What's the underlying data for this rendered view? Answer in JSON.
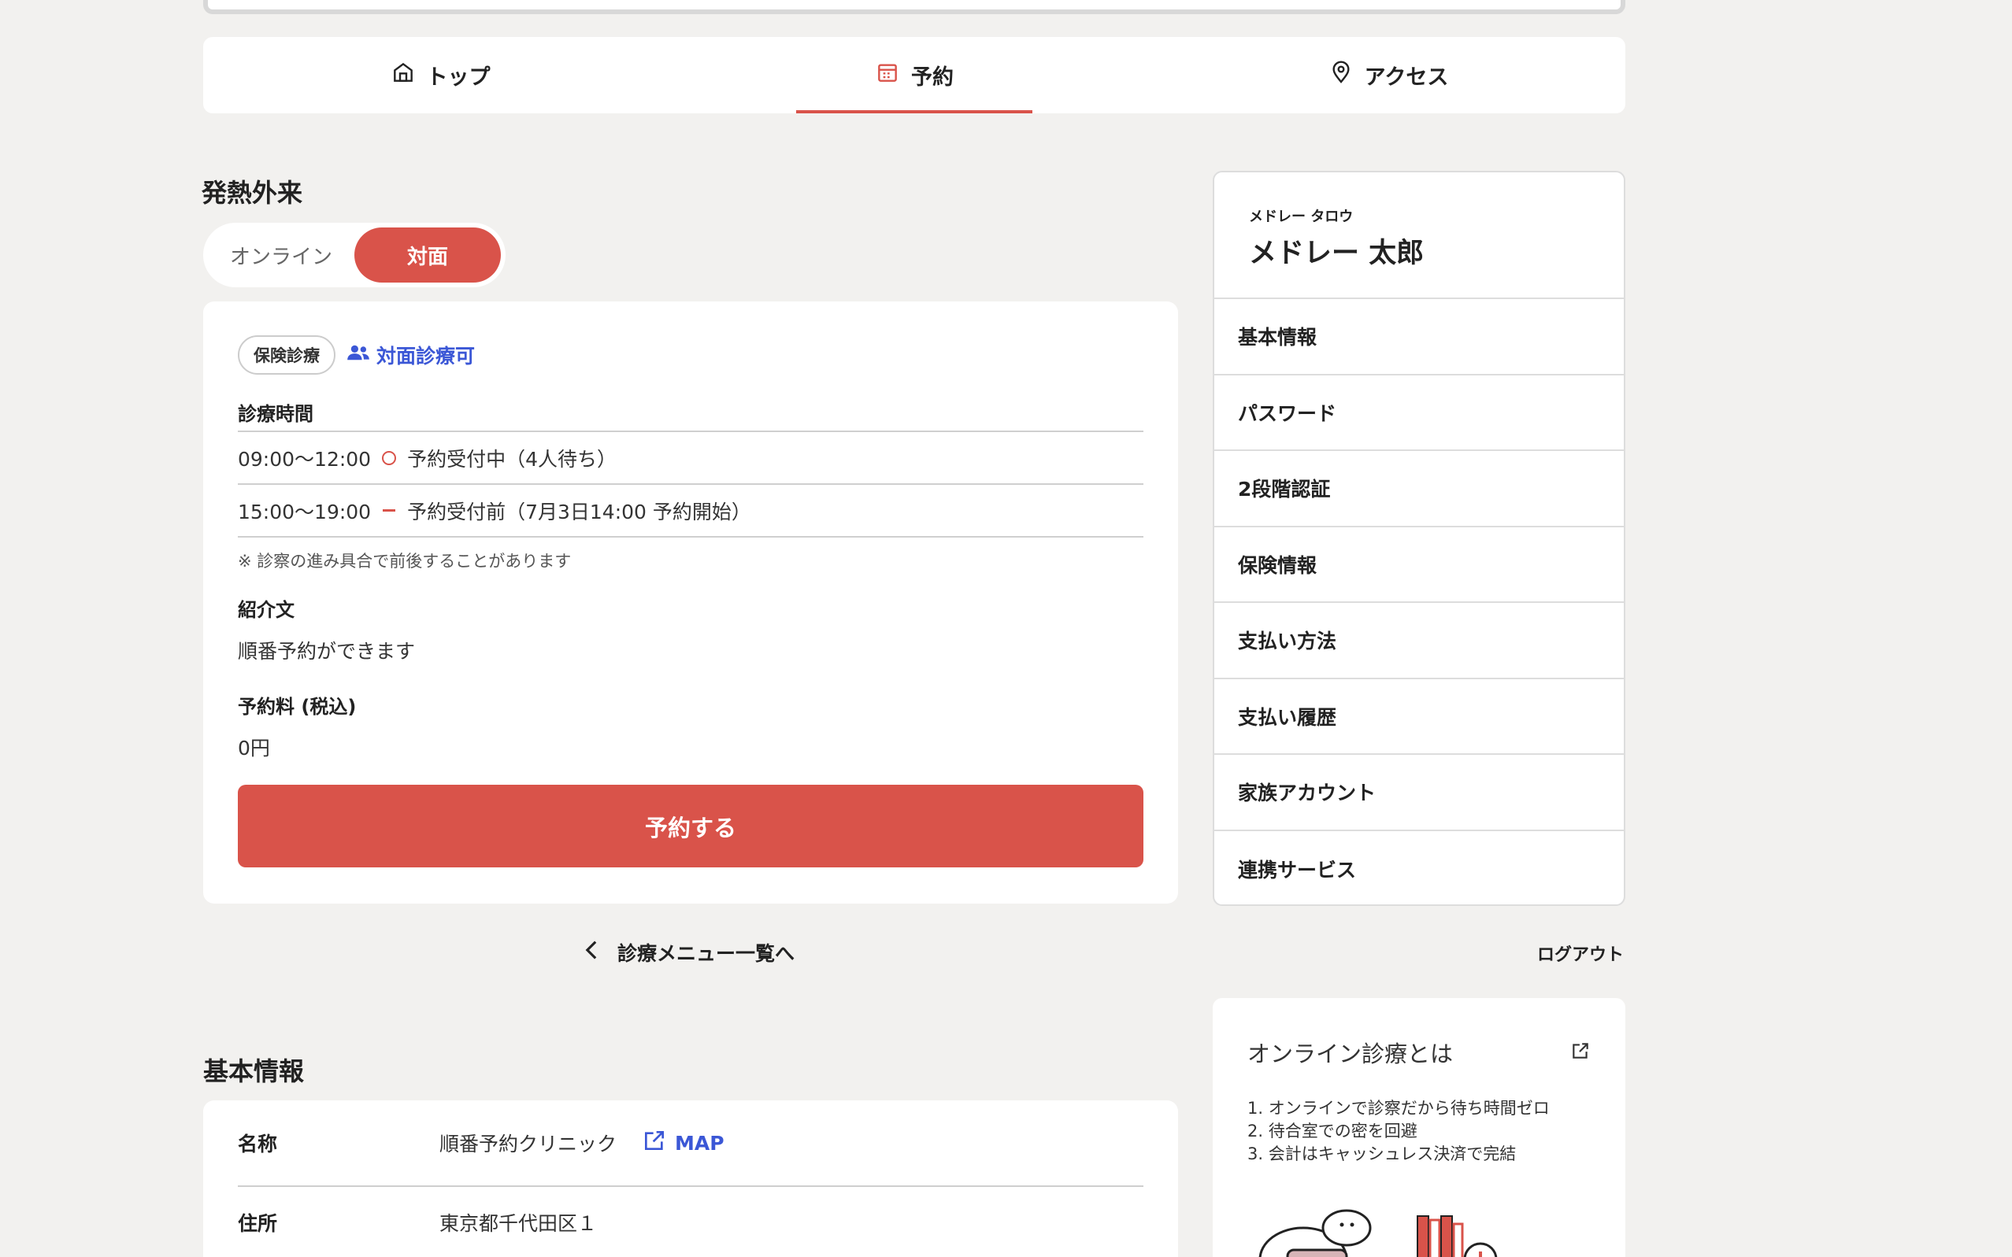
{
  "tabs": [
    {
      "label": "トップ",
      "icon": "home-icon"
    },
    {
      "label": "予約",
      "icon": "calendar-icon",
      "active": true
    },
    {
      "label": "アクセス",
      "icon": "map-pin-icon"
    }
  ],
  "section_title": "発熱外来",
  "mode_toggle": {
    "online": "オンライン",
    "in_person": "対面",
    "selected": "対面"
  },
  "card": {
    "insurance_badge": "保険診療",
    "in_person_link": "対面診療可",
    "hours_label": "診療時間",
    "hours": [
      {
        "time": "09:00〜12:00",
        "status_icon": "circle",
        "status": "予約受付中（4人待ち）"
      },
      {
        "time": "15:00〜19:00",
        "status_icon": "dash",
        "status": "予約受付前（7月3日14:00 予約開始）"
      }
    ],
    "note": "※ 診察の進み具合で前後することがあります",
    "intro_label": "紹介文",
    "intro_text": "順番予約ができます",
    "fee_label": "予約料 (税込)",
    "fee_value": "0円",
    "reserve_button": "予約する"
  },
  "back_link": "診療メニュー一覧へ",
  "basic_info": {
    "title": "基本情報",
    "rows": [
      {
        "key": "名称",
        "value": "順番予約クリニック",
        "link": "MAP"
      },
      {
        "key": "住所",
        "value": "東京都千代田区１"
      }
    ]
  },
  "user": {
    "kana": "メドレー タロウ",
    "name": "メドレー 太郎",
    "menu": [
      "基本情報",
      "パスワード",
      "2段階認証",
      "保険情報",
      "支払い方法",
      "支払い履歴",
      "家族アカウント",
      "連携サービス"
    ]
  },
  "logout": "ログアウト",
  "about": {
    "title": "オンライン診療とは",
    "points": [
      "1. オンラインで診察だから待ち時間ゼロ",
      "2. 待合室での密を回避",
      "3. 会計はキャッシュレス決済で完結"
    ]
  },
  "colors": {
    "accent": "#d9534a",
    "link": "#3b57d6",
    "background": "#f2f1ef"
  }
}
